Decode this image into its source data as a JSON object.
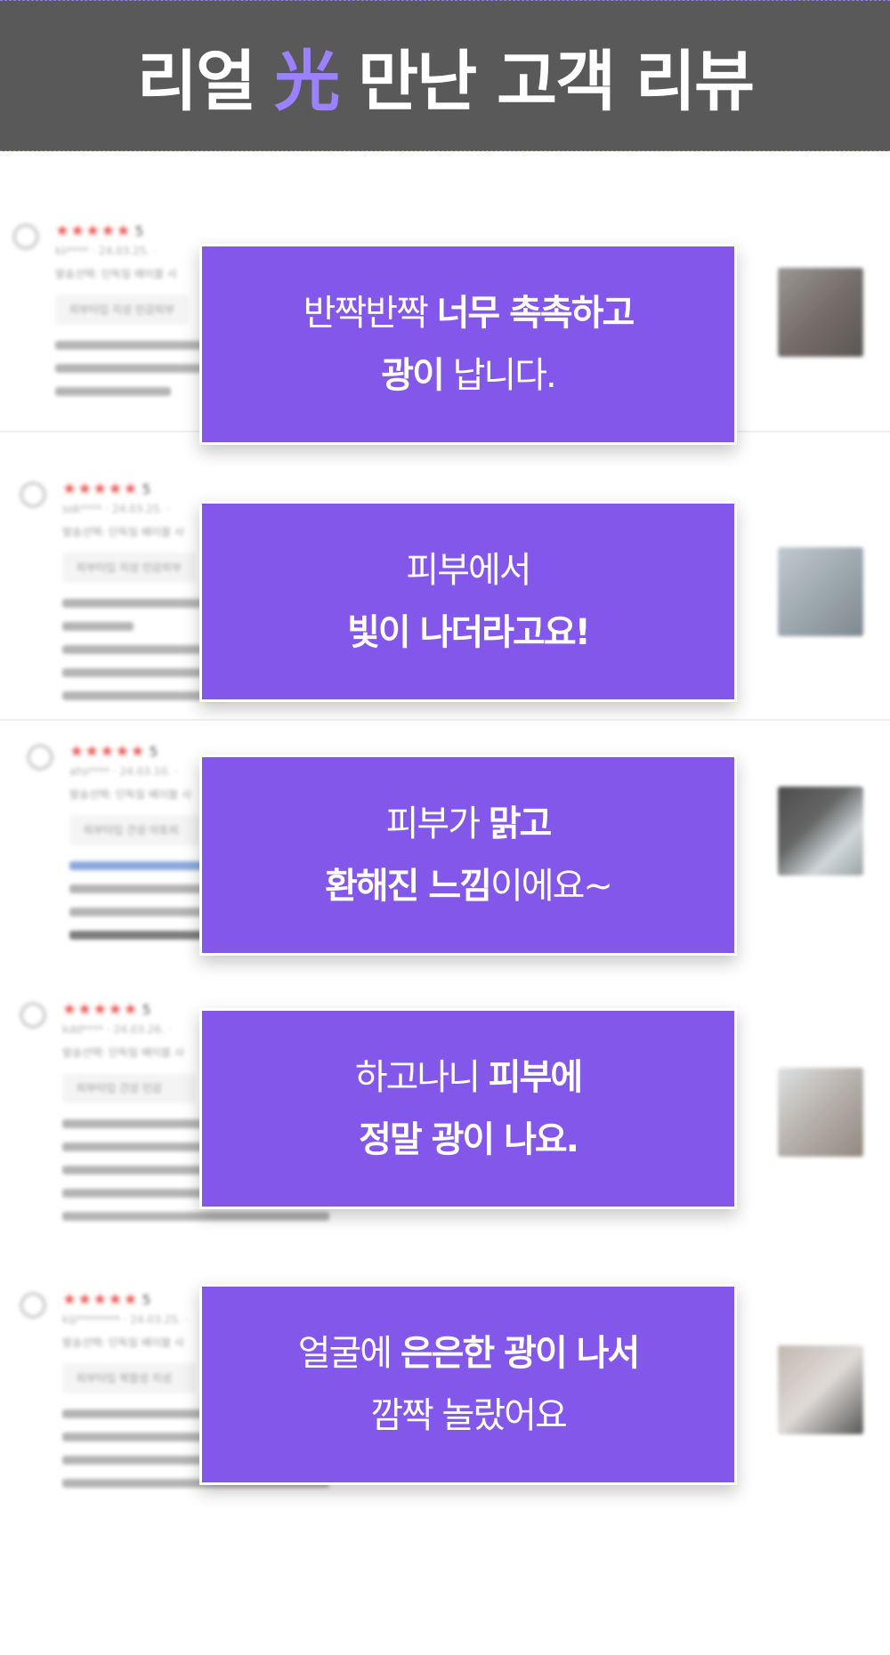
{
  "header": {
    "title_a": "리얼",
    "title_accent": "光",
    "title_b": "만난 고객 리뷰"
  },
  "reviews": [
    {
      "stars": "★★★★★",
      "score": "5",
      "meta": "kii**** · 24.03.25. ·",
      "option": "발송선택: 단독일 배이블 사",
      "tag": "피부타입 지성 민감피부",
      "thumb_color": "#6f6a68"
    },
    {
      "stars": "★★★★★",
      "score": "5",
      "meta": "sok**** · 24.03.25. ·",
      "option": "발송선택: 단독일 배이블 사",
      "tag": "피부타입 지성 민감피부",
      "thumb_color": "#8e9aa3"
    },
    {
      "stars": "★★★★★",
      "score": "5",
      "meta": "ahs**** · 24.03.10. ·",
      "option": "발송선택: 단독일 배이블 사",
      "tag": "피부타입 건성 아토피",
      "thumb_color": "#3d3d3d"
    },
    {
      "stars": "★★★★★",
      "score": "5",
      "meta": "kdd**** · 24.03.26. ·",
      "option": "발송선택: 단독일 배이블 사",
      "tag": "피부타입 건성 민감",
      "thumb_color": "#9c9791"
    },
    {
      "stars": "★★★★★",
      "score": "5",
      "meta": "kiji******** · 24.03.25. ·",
      "option": "발송선택: 단독일 배이블 사",
      "tag": "피부타입 복합성 지성",
      "thumb_color": "#7d756f"
    }
  ],
  "cards": [
    {
      "l1_reg": "반짝반짝 ",
      "l1_bold": "너무 촉촉하고",
      "l2_bold": "광이",
      "l2_reg": " 납니다."
    },
    {
      "l1_reg": "피부에서",
      "l1_bold": "",
      "l2_bold": "빛이 나더라고요!",
      "l2_reg": ""
    },
    {
      "l1_reg": "피부가 ",
      "l1_bold": "맑고",
      "l2_bold": "환해진 느낌",
      "l2_reg": "이에요~"
    },
    {
      "l1_reg": "하고나니 ",
      "l1_bold": "피부에",
      "l2_bold": "정말 광이 나요.",
      "l2_reg": ""
    },
    {
      "l1_reg": "얼굴에 ",
      "l1_bold": "은은한 광이 나서",
      "l2_bold": "",
      "l2_reg": "깜짝 놀랐어요"
    }
  ]
}
